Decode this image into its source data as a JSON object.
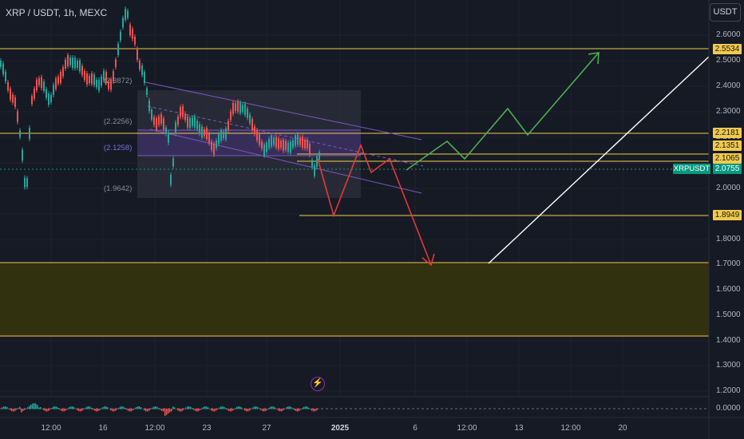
{
  "header": {
    "symbol": "XRP / USDT, 1h, MEXC",
    "currency_button": "USDT"
  },
  "price_axis": {
    "labels": [
      "2.6000",
      "2.5000",
      "2.4000",
      "2.3000",
      "2.2000",
      "2.1000",
      "2.0000",
      "1.9000",
      "1.8000",
      "1.7000",
      "1.6000",
      "1.5000",
      "1.4000",
      "1.3000",
      "1.2000"
    ],
    "indicator_zero": "0.0000"
  },
  "price_tags": {
    "level_top": "2.5534",
    "level_upper": "2.2181",
    "level_mid": "2.1351",
    "level_low": "2.1065",
    "current": "2.0755",
    "current_symbol": "XRPUSDT",
    "support": "1.8949"
  },
  "range_box_labels": [
    "(2.3872)",
    "(2.2256)",
    "(2.1258)",
    "(1.9642)"
  ],
  "time_axis": {
    "labels": [
      "12:00",
      "16",
      "12:00",
      "23",
      "27",
      "2025",
      "6",
      "12:00",
      "13",
      "12:00",
      "20"
    ]
  },
  "colors": {
    "background": "#161a25",
    "level_line": "#f2c94c",
    "zone_fill": "#3a3a12",
    "channel": "#7e57c2",
    "bull_path": "#4caf50",
    "bear_path": "#e53935",
    "up_candle": "#26a69a",
    "down_candle": "#ef5350"
  },
  "icons": {
    "bolt": "lightning-bolt-icon"
  }
}
